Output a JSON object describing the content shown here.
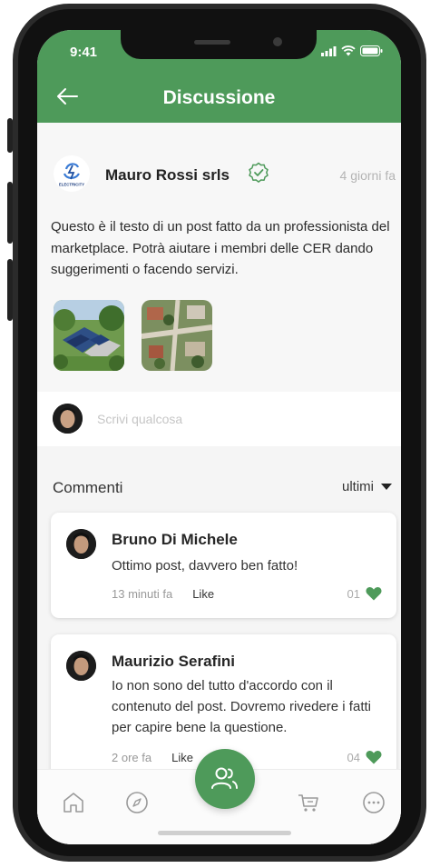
{
  "status_bar": {
    "time": "9:41"
  },
  "header": {
    "title": "Discussione",
    "back_icon": "arrow-left-icon",
    "color": "#4e9a5a"
  },
  "post": {
    "author": "Mauro Rossi srls",
    "logo_text": "ELECTRICITY",
    "time_ago": "4 giorni fa",
    "text": "Questo è il testo di un post fatto da un professionista del marketplace. Potrà aiutare i membri delle CER dando suggerimenti o facendo servizi.",
    "images": [
      "solar-houses-photo",
      "aerial-neighborhood-photo"
    ]
  },
  "composer": {
    "placeholder": "Scrivi qualcosa"
  },
  "comments": {
    "heading": "Commenti",
    "sort_label": "ultimi",
    "items": [
      {
        "name": "Bruno Di Michele",
        "text": "Ottimo post, davvero ben fatto!",
        "time": "13 minuti fa",
        "like_label": "Like",
        "likes": "01"
      },
      {
        "name": "Maurizio Serafini",
        "text": "Io non sono del tutto d'accordo con il contenuto del post. Dovremo rivedere i fatti per capire bene la questione.",
        "time": "2 ore fa",
        "like_label": "Like",
        "likes": "04"
      }
    ]
  },
  "tabbar": {
    "items": [
      "home-icon",
      "compass-icon",
      "community-icon",
      "cart-icon",
      "more-icon"
    ],
    "active": "community-icon"
  },
  "colors": {
    "accent": "#4e9a5a",
    "heart": "#4e9a5a"
  }
}
